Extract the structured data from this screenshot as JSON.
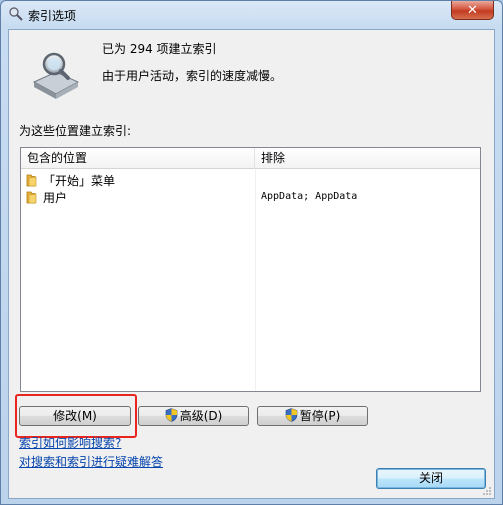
{
  "window": {
    "title": "索引选项",
    "icons": {
      "title": "indexing-options-icon",
      "close": "close-icon",
      "drive": "hard-drive-search-icon"
    },
    "colors": {
      "highlight": "#e8261e",
      "link": "#0645ad",
      "close_button": "#c23b21"
    }
  },
  "status": {
    "count_text": "已为 294 项建立索引",
    "note": "由于用户活动，索引的速度减慢。"
  },
  "locations": {
    "section_label": "为这些位置建立索引:",
    "columns": {
      "included": "包含的位置",
      "excluded": "排除"
    },
    "rows": [
      {
        "location": "「开始」菜单",
        "exclude": "",
        "icon": "folder-icon"
      },
      {
        "location": "用户",
        "exclude": "AppData; AppData",
        "icon": "folder-icon"
      }
    ]
  },
  "buttons": {
    "modify": "修改(M)",
    "advanced": "高级(D)",
    "pause": "暂停(P)",
    "close": "关闭"
  },
  "links": {
    "how_indexing_affects_search": "索引如何影响搜索?",
    "troubleshoot": "对搜索和索引进行疑难解答"
  }
}
